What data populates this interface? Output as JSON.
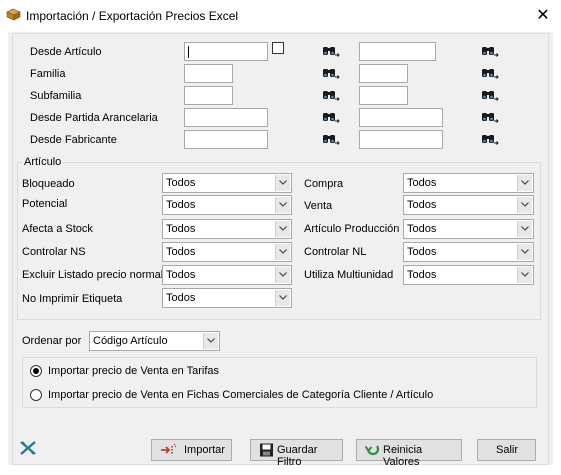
{
  "window": {
    "title": "Importación / Exportación Precios Excel",
    "close_glyph": "✕"
  },
  "filters": [
    {
      "label": "Desde Artículo",
      "from_value": "",
      "has_checkbox": true,
      "checkbox_checked": false,
      "to_value": ""
    },
    {
      "label": "Familia",
      "from_value": "",
      "to_value": ""
    },
    {
      "label": "Subfamilia",
      "from_value": "",
      "to_value": ""
    },
    {
      "label": "Desde Partida Arancelaria",
      "from_value": "",
      "to_value": ""
    },
    {
      "label": "Desde Fabricante",
      "from_value": "",
      "to_value": ""
    }
  ],
  "articulo": {
    "group_title": "Artículo",
    "left": [
      {
        "label": "Bloqueado",
        "value": "Todos"
      },
      {
        "label": "Potencial",
        "value": "Todos"
      },
      {
        "label": "Afecta a Stock",
        "value": "Todos"
      },
      {
        "label": "Controlar NS",
        "value": "Todos"
      },
      {
        "label": "Excluir Listado precio normal",
        "value": "Todos"
      },
      {
        "label": "No Imprimir Etiqueta",
        "value": "Todos"
      }
    ],
    "right": [
      {
        "label": "Compra",
        "value": "Todos"
      },
      {
        "label": "Venta",
        "value": "Todos"
      },
      {
        "label": "Artículo Producción",
        "value": "Todos"
      },
      {
        "label": "Controlar NL",
        "value": "Todos"
      },
      {
        "label": "Utiliza Multiunidad",
        "value": "Todos"
      }
    ]
  },
  "order": {
    "label": "Ordenar por",
    "value": "Código Artículo"
  },
  "import_options": [
    {
      "label": "Importar precio de Venta en Tarifas",
      "selected": true
    },
    {
      "label": "Importar precio de Venta en Fichas Comerciales de Categoría Cliente / Artículo",
      "selected": false
    }
  ],
  "buttons": {
    "importar": "Importar",
    "guardar": "Guardar Filtro",
    "reinicia": "Reinicia Valores",
    "salir": "Salir"
  },
  "colors": {
    "dialog_bg": "#f0f0f0",
    "border": "#dcdcdc",
    "button_bg": "#e1e1e1"
  }
}
